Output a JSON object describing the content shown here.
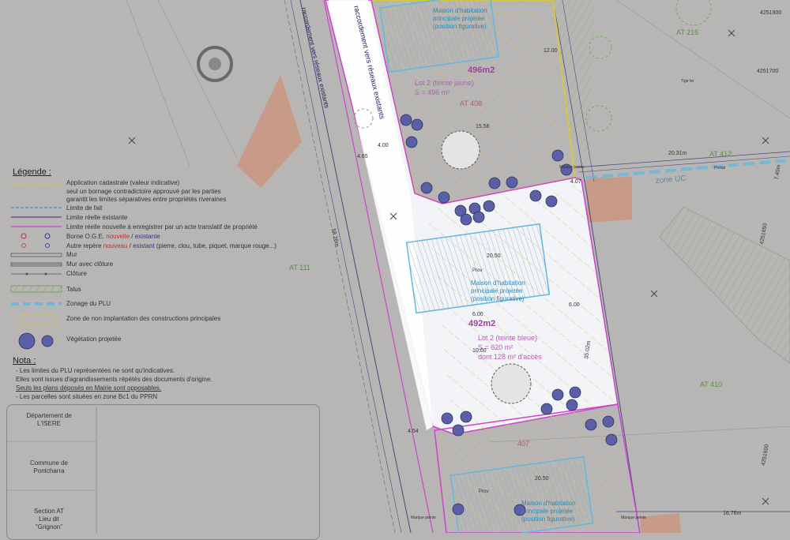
{
  "colors": {
    "background": "#b8b6b4",
    "lot_blue_fill": "#f2f4f8",
    "lot_yellow_border": "#d8c840",
    "limit_pink": "#cc44cc",
    "zoning_cyan": "#60b8e0",
    "road_label": "#1a1a5a",
    "brown_parcel": "#c89a88",
    "tree_blue": "#5a5fa8"
  },
  "map": {
    "access_label": "raccordement vers réseaux existants",
    "access_label_2": "raccordement vers réseaux existants",
    "lot_top_area": "496m2",
    "lot_top_desc_1": "Lot 2 (teinte jaune)",
    "lot_top_desc_2": "S = 496 m²",
    "lot_top_parcel": "AT 408",
    "house_top_1": "Maison d'habitation",
    "house_top_2": "principale projetée",
    "house_top_3": "(position figurative)",
    "lot_main_area": "492m2",
    "lot_main_desc_1": "Lot 2 (teinte bleue)",
    "lot_main_desc_2": "S = 620 m²",
    "lot_main_desc_3": "dont 128 m² d'accès",
    "house_main_1": "Maison d'habitation",
    "house_main_2": "principale projetée",
    "house_main_3": "(position figurative)",
    "house_bottom_1": "Maison d'habitation",
    "house_bottom_2": "principale projetée",
    "house_bottom_3": "(position figurative)",
    "parcel_407": "407",
    "parcel_at216": "AT 216",
    "parcel_at412": "AT 412",
    "parcel_at111": "AT 111",
    "parcel_at410": "AT 410",
    "zone_uc": "zone UC",
    "coord_1": "4251700",
    "coord_2": "4251650",
    "coord_3": "4251600",
    "coord_top": "4251900",
    "dim_2031": "20.31m",
    "dim_745": "7.45m",
    "dim_3502": "35.02m",
    "dim_1876": "16.76m",
    "dim_5826": "58.26m",
    "dim_2050": "20.50",
    "dim_2050b": "20.50",
    "dim_1556": "15.56",
    "dim_600a": "6.00",
    "dim_600b": "6.00",
    "dim_454": "4.54",
    "dim_465": "4.65",
    "dim_400": "4.00",
    "dim_1200": "12.00",
    "dim_1000": "10.00",
    "dim_407b": "4.07",
    "marker_prov_1": "Prov",
    "marker_prov_2": "Prov",
    "marker_piquet_1": "Marque peinte",
    "marker_piquet_2": "Marque peinte",
    "marker_piquet_3": "Marque peinte",
    "tige_fer": "Tige fer",
    "portail": "Portail"
  },
  "legend": {
    "title": "Légende :",
    "rows": [
      "Application cadastrale (valeur indicative)",
      "seul un bornage contradictoire approuvé par les parties",
      "garantit les limites séparatives entre propriétés riveraines",
      "Limite de fait",
      "Limite réelle existante",
      "Limite réelle nouvelle à enregistrer par un acte translatif de propriété"
    ],
    "borne_prefix": "Borne O.G.E. ",
    "borne_new": "nouvelle",
    "borne_sep": " / ",
    "borne_existing": "existante",
    "repere_prefix": "Autre repère ",
    "repere_new": "nouveau",
    "repere_sep": " / ",
    "repere_existing": "existant",
    "repere_suffix": " (pierre, clou, tube, piquet, marque rouge...)",
    "mur": "Mur",
    "mur_cloture": "Mur avec clôture",
    "cloture": "Clôture",
    "talus": "Talus",
    "zonage": "Zonage du PLU",
    "non_implantation": "Zone de non implantation des constructions principales",
    "vegetation": "Végétation projetée"
  },
  "nota": {
    "title": "Nota :",
    "lines": [
      "- Les limites du PLU représentées ne sont qu'indicatives.",
      "Elles sont issues d'agrandissements répétés des documents d'origine.",
      "Seuls les plans déposés en Mairie sont opposables.",
      "- Les parcelles sont situées en zone Bc1 du PPRN"
    ]
  },
  "cartouche": {
    "dept_1": "Département de",
    "dept_2": "L'ISERE",
    "commune_1": "Commune de",
    "commune_2": "Pontcharra",
    "section_1": "Section AT",
    "section_2": "Lieu dit",
    "section_3": "\"Grignon\""
  }
}
